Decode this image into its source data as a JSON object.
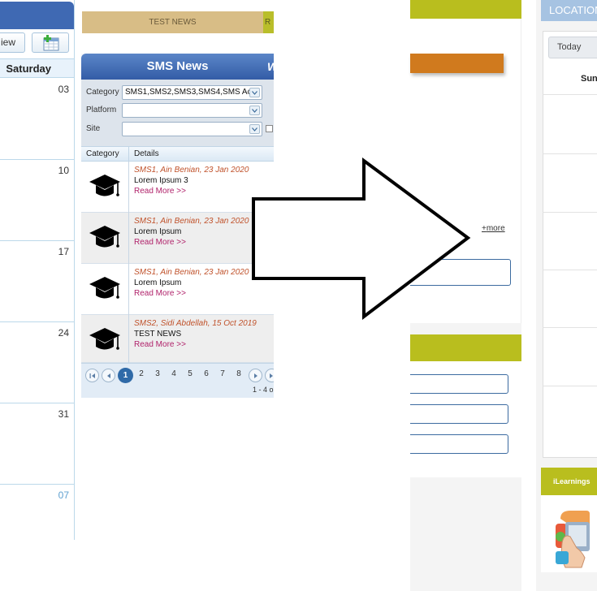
{
  "calendar": {
    "view_label": "iew",
    "day_header": "Saturday",
    "dates": [
      "03",
      "10",
      "17",
      "24",
      "31",
      "07"
    ]
  },
  "news_tab": {
    "label": "TEST NEWS",
    "next_label": "R"
  },
  "sms_news": {
    "title": "SMS News",
    "title_tail": "W",
    "filters": {
      "category_label": "Category",
      "category_value": "SMS1,SMS2,SMS3,SMS4,SMS Ac",
      "platform_label": "Platform",
      "platform_value": "",
      "site_label": "Site",
      "site_value": ""
    },
    "columns": [
      "Category",
      "Details"
    ],
    "items": [
      {
        "meta": "SMS1, Ain Benian, 23 Jan 2020",
        "title": "Lorem Ipsum 3",
        "link": "Read More >>",
        "icon": "graduation-cap-icon"
      },
      {
        "meta": "SMS1, Ain Benian, 23 Jan 2020",
        "title": "Lorem Ipsum",
        "link": "Read More >>",
        "icon": "graduation-cap-icon"
      },
      {
        "meta": "SMS1, Ain Benian, 23 Jan 2020",
        "title": "Lorem Ipsum",
        "link": "Read More >>",
        "icon": "graduation-cap-icon"
      },
      {
        "meta": "SMS2, Sidi Abdellah, 15 Oct 2019",
        "title": "TEST NEWS",
        "link": "Read More >>",
        "icon": "graduation-cap-icon"
      }
    ],
    "pager": {
      "pages": [
        "1",
        "2",
        "3",
        "4",
        "5",
        "6",
        "7",
        "8"
      ],
      "current": "1",
      "info": "1 - 4 o"
    }
  },
  "middle_panel": {
    "more_link": "more",
    "more_prefix": "+"
  },
  "right_panel": {
    "header": "LOCATION",
    "today_button": "Today",
    "day_header": "Sun",
    "ilearnings_label": "iLearnings"
  },
  "colors": {
    "blue_header": "#3f69b3",
    "olive_bar": "#b9be1e",
    "orange_bar": "#d07a1e",
    "tan_tab": "#d8bd86",
    "link_magenta": "#b0226a",
    "meta_orange": "#c0522b"
  }
}
